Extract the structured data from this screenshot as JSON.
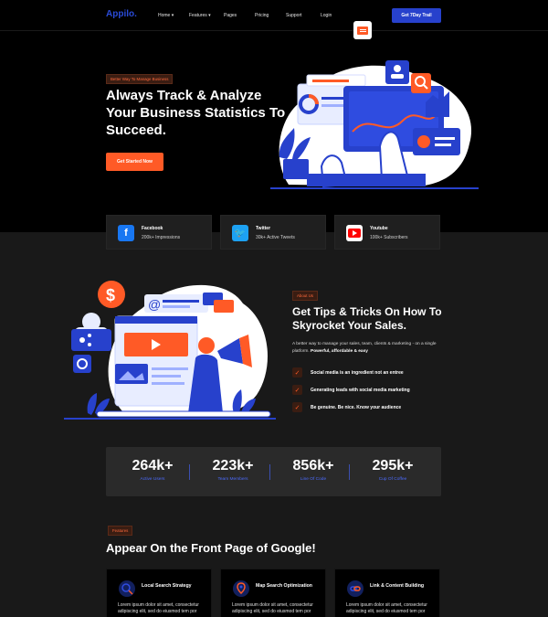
{
  "header": {
    "logo": "Appilo.",
    "nav": [
      {
        "label": "Home",
        "has_dropdown": true
      },
      {
        "label": "Features",
        "has_dropdown": true
      },
      {
        "label": "Pages",
        "has_dropdown": false
      },
      {
        "label": "Pricing",
        "has_dropdown": false
      },
      {
        "label": "Support",
        "has_dropdown": false
      },
      {
        "label": "Login",
        "has_dropdown": false
      }
    ],
    "cta": "Get 7Day Trail"
  },
  "hero": {
    "badge": "Better Way To Manage Business",
    "title": "Always Track & Analyze Your Business Statistics To Succeed.",
    "button": "Get Started Now"
  },
  "social": [
    {
      "name": "Facebook",
      "stat": "200k+ Impressions",
      "icon": "facebook-icon",
      "color": "#1877f2"
    },
    {
      "name": "Twitter",
      "stat": "30k+ Active Tweets",
      "icon": "twitter-icon",
      "color": "#1da1f2"
    },
    {
      "name": "Youtube",
      "stat": "100k+ Subscribers",
      "icon": "youtube-icon",
      "color": "#ff0000"
    }
  ],
  "about": {
    "badge": "About Us",
    "title": "Get Tips & Tricks On How To Skyrocket Your Sales.",
    "desc": "A better way to manage your sales, team, clients & marketing - on a single platform.",
    "desc_bold": "Powerful, affordable & easy",
    "checks": [
      "Social media is an ingredient not an entree",
      "Generating leads with social media marketing",
      "Be genuine. Be nice. Know your audience"
    ]
  },
  "stats": [
    {
      "value": "264k+",
      "label": "Active Users"
    },
    {
      "value": "223k+",
      "label": "Team Members"
    },
    {
      "value": "856k+",
      "label": "Line Of Code"
    },
    {
      "value": "295k+",
      "label": "Cup Of Coffee"
    }
  ],
  "features": {
    "badge": "Features",
    "title": "Appear On the Front Page of Google!",
    "cards": [
      {
        "title": "Local Search Strategy",
        "desc": "Lorem ipsum dolor sit amet, consectetur adipiscing elit, sed do eiusmod tem por",
        "icon": "local-search-icon"
      },
      {
        "title": "Map Search Optimization",
        "desc": "Lorem ipsum dolor sit amet, consectetur adipiscing elit, sed do eiusmod tem por",
        "icon": "map-search-icon"
      },
      {
        "title": "Link & Content Building",
        "desc": "Lorem ipsum dolor sit amet, consectetur adipiscing elit, sed do eiusmod tem por",
        "icon": "link-content-icon"
      }
    ]
  },
  "colors": {
    "accent": "#ff5a26",
    "brand": "#2741cc",
    "background": "#191919"
  }
}
